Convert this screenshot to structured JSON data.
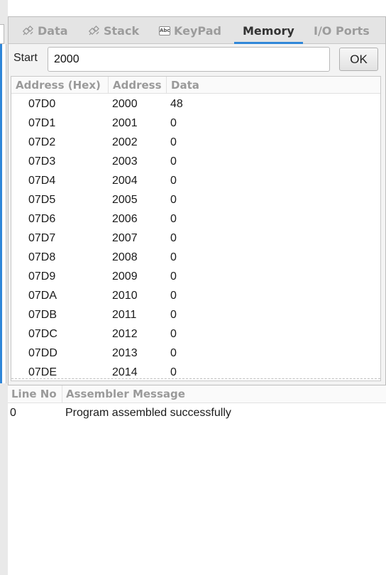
{
  "tabs": [
    {
      "label": "Data",
      "icon": "chip-icon",
      "active": false
    },
    {
      "label": "Stack",
      "icon": "chip-icon",
      "active": false
    },
    {
      "label": "KeyPad",
      "icon": "keypad-icon",
      "active": false
    },
    {
      "label": "Memory",
      "icon": "",
      "active": true
    },
    {
      "label": "I/O Ports",
      "icon": "",
      "active": false
    }
  ],
  "keypad_icon_text": "Abc",
  "start": {
    "label": "Start",
    "value": "2000",
    "ok_label": "OK"
  },
  "memory_table": {
    "headers": [
      "Address (Hex)",
      "Address",
      "Data"
    ],
    "rows": [
      {
        "hex": "07D0",
        "dec": "2000",
        "data": "48"
      },
      {
        "hex": "07D1",
        "dec": "2001",
        "data": "0"
      },
      {
        "hex": "07D2",
        "dec": "2002",
        "data": "0"
      },
      {
        "hex": "07D3",
        "dec": "2003",
        "data": "0"
      },
      {
        "hex": "07D4",
        "dec": "2004",
        "data": "0"
      },
      {
        "hex": "07D5",
        "dec": "2005",
        "data": "0"
      },
      {
        "hex": "07D6",
        "dec": "2006",
        "data": "0"
      },
      {
        "hex": "07D7",
        "dec": "2007",
        "data": "0"
      },
      {
        "hex": "07D8",
        "dec": "2008",
        "data": "0"
      },
      {
        "hex": "07D9",
        "dec": "2009",
        "data": "0"
      },
      {
        "hex": "07DA",
        "dec": "2010",
        "data": "0"
      },
      {
        "hex": "07DB",
        "dec": "2011",
        "data": "0"
      },
      {
        "hex": "07DC",
        "dec": "2012",
        "data": "0"
      },
      {
        "hex": "07DD",
        "dec": "2013",
        "data": "0"
      },
      {
        "hex": "07DE",
        "dec": "2014",
        "data": "0"
      }
    ]
  },
  "messages": {
    "headers": [
      "Line No",
      "Assembler Message"
    ],
    "rows": [
      {
        "line": "0",
        "message": "Program assembled successfully"
      }
    ]
  },
  "colors": {
    "accent": "#2f86d8",
    "inactive_tab": "#9c9c9c",
    "active_tab": "#333333"
  }
}
